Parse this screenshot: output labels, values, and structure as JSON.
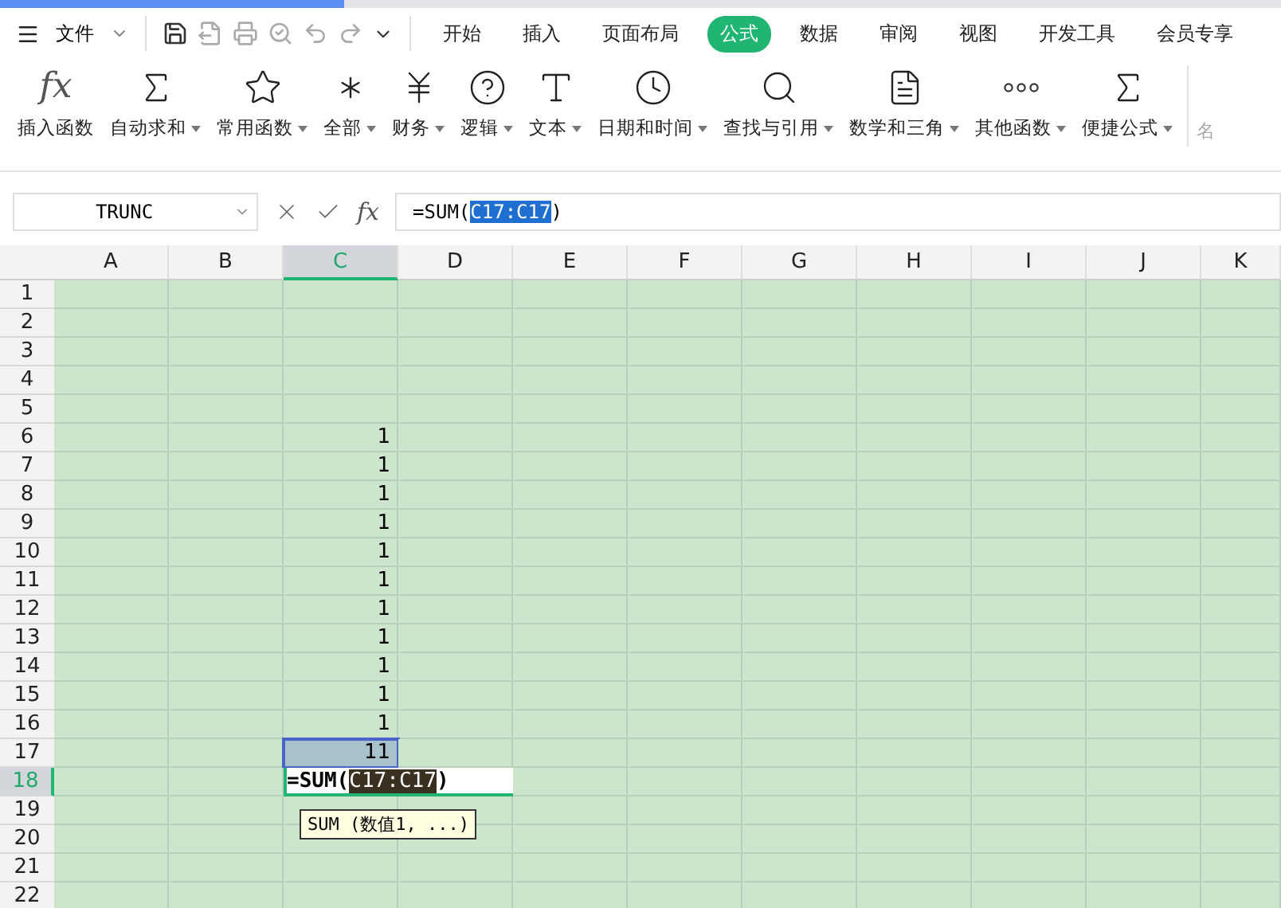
{
  "menu": {
    "file": "文件",
    "tabs": [
      {
        "label": "开始",
        "selected": false
      },
      {
        "label": "插入",
        "selected": false
      },
      {
        "label": "页面布局",
        "selected": false
      },
      {
        "label": "公式",
        "selected": true
      },
      {
        "label": "数据",
        "selected": false
      },
      {
        "label": "审阅",
        "selected": false
      },
      {
        "label": "视图",
        "selected": false
      },
      {
        "label": "开发工具",
        "selected": false
      },
      {
        "label": "会员专享",
        "selected": false
      }
    ]
  },
  "ribbon": [
    {
      "label": "插入函数",
      "glyph": "fx",
      "dropdown": false,
      "disabled": false
    },
    {
      "label": "自动求和",
      "dropdown": true,
      "disabled": false
    },
    {
      "label": "常用函数",
      "dropdown": true,
      "disabled": false
    },
    {
      "label": "全部",
      "dropdown": true,
      "disabled": false
    },
    {
      "label": "财务",
      "dropdown": true,
      "disabled": false
    },
    {
      "label": "逻辑",
      "dropdown": true,
      "disabled": false
    },
    {
      "label": "文本",
      "dropdown": true,
      "disabled": false
    },
    {
      "label": "日期和时间",
      "dropdown": true,
      "disabled": false
    },
    {
      "label": "查找与引用",
      "dropdown": true,
      "disabled": false
    },
    {
      "label": "数学和三角",
      "dropdown": true,
      "disabled": false
    },
    {
      "label": "其他函数",
      "dropdown": true,
      "disabled": false
    },
    {
      "label": "便捷公式",
      "dropdown": true,
      "disabled": false
    },
    {
      "label": "名",
      "dropdown": false,
      "disabled": true
    }
  ],
  "formula_bar": {
    "name_box": "TRUNC",
    "fx": "fx",
    "prefix": "=SUM(",
    "highlight": "C17:C17",
    "suffix": ")"
  },
  "sheet": {
    "columns": [
      {
        "label": "A",
        "selected": false
      },
      {
        "label": "B",
        "selected": false
      },
      {
        "label": "C",
        "selected": true
      },
      {
        "label": "D",
        "selected": false
      },
      {
        "label": "E",
        "selected": false
      },
      {
        "label": "F",
        "selected": false
      },
      {
        "label": "G",
        "selected": false
      },
      {
        "label": "H",
        "selected": false
      },
      {
        "label": "I",
        "selected": false
      },
      {
        "label": "J",
        "selected": false
      },
      {
        "label": "K",
        "selected": false
      }
    ],
    "rows": [
      {
        "label": "1",
        "selected": false,
        "c": ""
      },
      {
        "label": "2",
        "selected": false,
        "c": ""
      },
      {
        "label": "3",
        "selected": false,
        "c": ""
      },
      {
        "label": "4",
        "selected": false,
        "c": ""
      },
      {
        "label": "5",
        "selected": false,
        "c": ""
      },
      {
        "label": "6",
        "selected": false,
        "c": "1"
      },
      {
        "label": "7",
        "selected": false,
        "c": "1"
      },
      {
        "label": "8",
        "selected": false,
        "c": "1"
      },
      {
        "label": "9",
        "selected": false,
        "c": "1"
      },
      {
        "label": "10",
        "selected": false,
        "c": "1"
      },
      {
        "label": "11",
        "selected": false,
        "c": "1"
      },
      {
        "label": "12",
        "selected": false,
        "c": "1"
      },
      {
        "label": "13",
        "selected": false,
        "c": "1"
      },
      {
        "label": "14",
        "selected": false,
        "c": "1"
      },
      {
        "label": "15",
        "selected": false,
        "c": "1"
      },
      {
        "label": "16",
        "selected": false,
        "c": "1"
      },
      {
        "label": "17",
        "selected": false,
        "c": "11"
      },
      {
        "label": "18",
        "selected": true,
        "c": ""
      },
      {
        "label": "19",
        "selected": false,
        "c": ""
      },
      {
        "label": "20",
        "selected": false,
        "c": ""
      },
      {
        "label": "21",
        "selected": false,
        "c": ""
      },
      {
        "label": "22",
        "selected": false,
        "c": ""
      }
    ],
    "editor": {
      "prefix": "=SUM(",
      "highlight": "C17:C17",
      "suffix": ")"
    },
    "tooltip": "SUM (数值1, ...)"
  }
}
